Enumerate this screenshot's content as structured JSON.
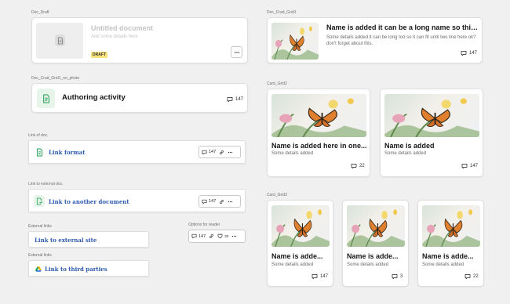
{
  "colors": {
    "background": "#f0f0f0",
    "card": "#ffffff",
    "link": "#2f5bb0",
    "doc_green": "#1f9d55",
    "draft_badge": "#f7e27c"
  },
  "labels": {
    "doc_draft": "Doc_Draft",
    "doc_grid1_no_photo": "Doc_Crad_Grid1_no_photo",
    "link_of_doc": "Link of doc.",
    "link_to_external_doc": "Link to external doc.",
    "external_links_1": "External links",
    "external_links_2": "External links",
    "options_for_reader": "Options for reader",
    "doc_grid1": "Doc_Crad_Grid1",
    "card_grid2": "Card_Grid2",
    "card_grid3": "Card_Grid3"
  },
  "draft": {
    "title": "Untitled document",
    "subtitle": "Add some details here",
    "badge": "DRAFT",
    "image_icon": "document-placeholder-icon",
    "more_icon": "more-horizontal-icon"
  },
  "authoring": {
    "title": "Authoring activity",
    "comments": "147",
    "doc_icon": "document-icon"
  },
  "link_format": {
    "text": "Link format",
    "comments": "147",
    "icons": [
      "document-icon",
      "link-icon",
      "more-horizontal-icon"
    ]
  },
  "link_another": {
    "text": "Link to another document",
    "comments": "147",
    "icons": [
      "document-export-icon",
      "link-icon",
      "more-horizontal-icon"
    ]
  },
  "link_external": {
    "text": "Link to external site"
  },
  "link_third": {
    "text": "Link to third parties",
    "icon": "google-drive-icon"
  },
  "reader_options": {
    "comments": "147",
    "likes": "33",
    "icons": [
      "comment-icon",
      "link-icon",
      "heart-icon",
      "more-horizontal-icon"
    ]
  },
  "grid1": {
    "title": "Name is added it can be a long name so this...",
    "subtitle": "Some details added it can be long too so it can fit until two line here ok? don't forget about this.",
    "comments": "147"
  },
  "grid2": [
    {
      "title": "Name is added here in one...",
      "subtitle": "Some details added",
      "comments": "22"
    },
    {
      "title": "Name is added",
      "subtitle": "Some details added",
      "comments": "147"
    }
  ],
  "grid3": [
    {
      "title": "Name is adde...",
      "subtitle": "Some details added",
      "comments": "147"
    },
    {
      "title": "Name is adde...",
      "subtitle": "Some details added",
      "comments": "3"
    },
    {
      "title": "Name is adde...",
      "subtitle": "Some details added",
      "comments": "22"
    }
  ]
}
